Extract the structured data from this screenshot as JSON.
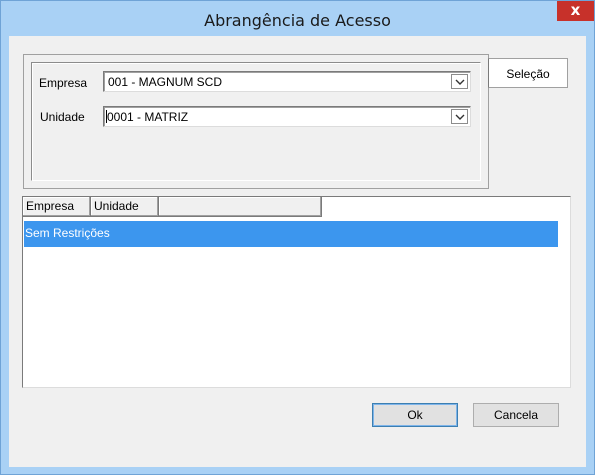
{
  "window": {
    "title": "Abrangência de Acesso",
    "close_label": "x"
  },
  "tab": {
    "label": "Seleção"
  },
  "selection": {
    "empresa_label": "Empresa",
    "empresa_value": "001 - MAGNUM SCD",
    "unidade_label": "Unidade",
    "unidade_value": "0001 - MATRIZ"
  },
  "list": {
    "columns": [
      "Empresa",
      "Unidade",
      ""
    ],
    "rows": [
      {
        "text": "Sem Restrições",
        "selected": true
      }
    ]
  },
  "buttons": {
    "ok_label": "Ok",
    "cancel_label": "Cancela"
  },
  "colors": {
    "title_bar": "#a9d1f5",
    "close_button": "#c7312a",
    "selection_highlight": "#3c96ee"
  },
  "icons": {
    "close": "close-icon",
    "dropdown": "chevron-down-icon"
  }
}
